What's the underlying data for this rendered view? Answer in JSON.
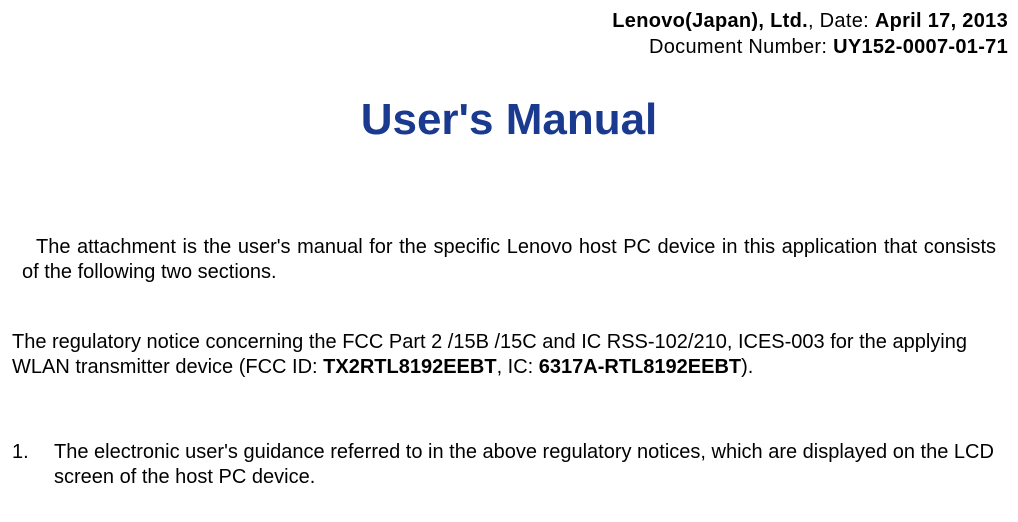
{
  "header": {
    "company": "Lenovo(Japan), Ltd.",
    "date_label": ", Date: ",
    "date_value": "April 17, 2013",
    "doc_label": "Document Number: ",
    "doc_number": "UY152-0007-01-71"
  },
  "title": "User's Manual",
  "intro": "The attachment is the user's manual for the specific Lenovo host PC device in this application that consists of the following two sections.",
  "reg_notice": {
    "pre": "The regulatory notice concerning the FCC Part 2 /15B /15C and IC RSS-102/210, ICES-003 for the applying WLAN transmitter device (FCC ID: ",
    "fcc_id": "TX2RTL8192EEBT",
    "mid": ",  IC: ",
    "ic_id": "6317A-RTL8192EEBT",
    "post": ")."
  },
  "list": {
    "items": [
      {
        "number": "1.",
        "text": "The electronic user's guidance referred to in the above regulatory notices, which are displayed on the LCD screen of the host PC device."
      }
    ]
  }
}
